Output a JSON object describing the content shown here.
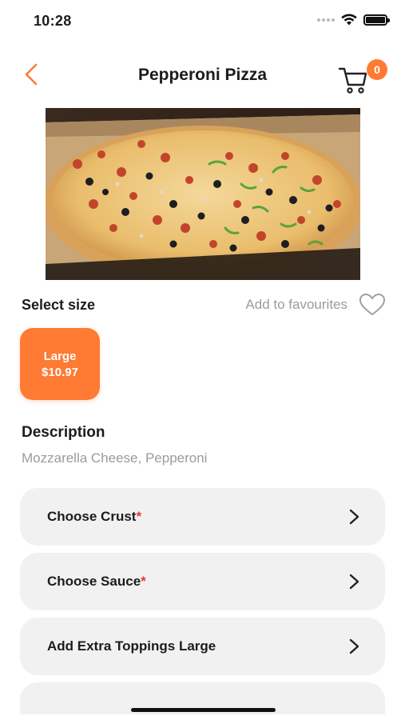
{
  "status_bar": {
    "time": "10:28"
  },
  "nav": {
    "title": "Pepperoni Pizza",
    "cart_count": "0",
    "back_icon": "chevron-left-icon",
    "cart_icon": "cart-icon",
    "accent_color": "#ff7a33"
  },
  "hero": {
    "alt": "Pepperoni pizza with olives and peppers"
  },
  "size_section": {
    "heading": "Select size",
    "favourite_label": "Add to favourites",
    "options": [
      {
        "name": "Large",
        "price": "$10.97",
        "selected": true
      }
    ]
  },
  "description": {
    "heading": "Description",
    "text": "Mozzarella Cheese, Pepperoni"
  },
  "options": [
    {
      "label": "Choose Crust",
      "required": "*"
    },
    {
      "label": "Choose Sauce",
      "required": "*"
    },
    {
      "label": "Add Extra Toppings Large",
      "required": ""
    }
  ]
}
